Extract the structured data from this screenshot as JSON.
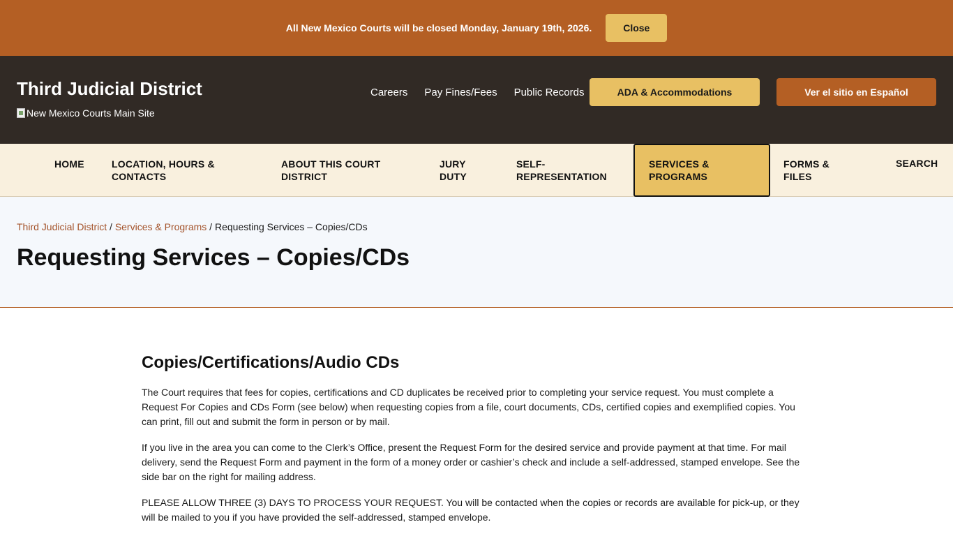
{
  "alert": {
    "message": "All New Mexico Courts will be closed Monday, January 19th, 2026.",
    "close_label": "Close"
  },
  "header": {
    "site_title": "Third Judicial District",
    "main_site_alt": "New Mexico Courts Main Site",
    "utility_links": [
      "Careers",
      "Pay Fines/Fees",
      "Public Records"
    ],
    "ada_label": "ADA & Accommodations",
    "spanish_label": "Ver el sitio en Español"
  },
  "nav": {
    "home": "HOME",
    "location": "LOCATION, HOURS & CONTACTS",
    "about": "ABOUT THIS COURT DISTRICT",
    "jury": "JURY DUTY",
    "self_rep": "SELF-REPRESENTATION",
    "services": "SERVICES & PROGRAMS",
    "forms": "FORMS & FILES",
    "search": "SEARCH"
  },
  "breadcrumb": {
    "crumb1": "Third Judicial District",
    "sep": " / ",
    "crumb2": "Services & Programs",
    "current": "Requesting Services – Copies/CDs"
  },
  "page": {
    "title": "Requesting Services – Copies/CDs"
  },
  "content": {
    "heading": "Copies/Certifications/Audio CDs",
    "p1": "The Court requires that fees for copies, certifications and CD duplicates be received prior to completing your service request. You must complete a Request For Copies and CDs Form (see below) when requesting copies from a file, court documents, CDs, certified copies and exemplified copies. You can print, fill out and submit the form in person or by mail.",
    "p2": "If you live in the area you can come to the Clerk’s Office, present the Request Form for the desired service and provide payment at that time. For mail delivery, send the Request Form and payment in the form of a money order or cashier’s check and include a self-addressed, stamped envelope. See the side bar on the right for mailing address.",
    "p3": "PLEASE ALLOW THREE (3) DAYS TO PROCESS YOUR REQUEST. You will be contacted when the copies or records are available for pick-up, or they will be mailed to you if you have provided the self-addressed, stamped envelope."
  }
}
